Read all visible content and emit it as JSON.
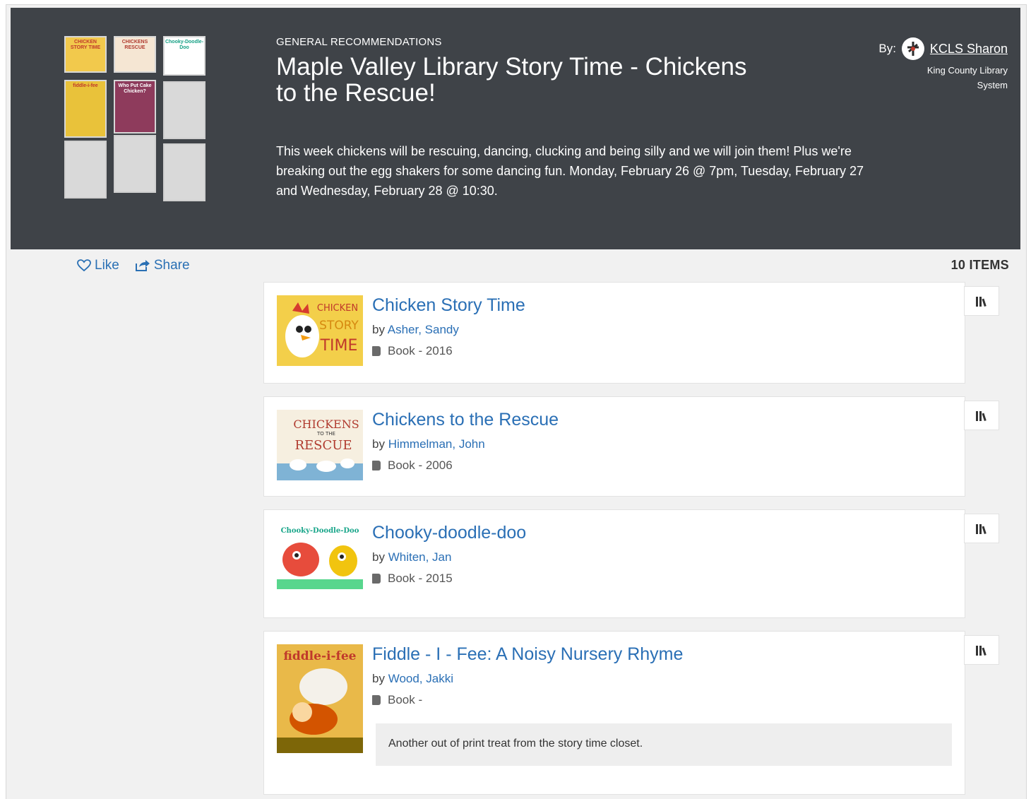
{
  "list": {
    "eyebrow": "GENERAL RECOMMENDATIONS",
    "title": "Maple Valley Library Story Time - Chickens to the Rescue!",
    "description": "This week chickens will be rescuing, dancing, clucking and being silly and we will join them! Plus we're breaking out the egg shakers for some dancing fun. Monday, February 26 @ 7pm, Tuesday, February 27 and Wednesday, February 28 @ 10:30.",
    "by_label": "By:",
    "author": "KCLS Sharon",
    "organization": "King County Library System"
  },
  "actions": {
    "like": "Like",
    "share": "Share"
  },
  "item_count": "10 ITEMS",
  "by_prefix": "by",
  "items": [
    {
      "title": "Chicken Story Time",
      "author": "Asher, Sandy",
      "format": "Book - 2016",
      "cover_text": [
        "CHICKEN",
        "STORY",
        "TIME"
      ]
    },
    {
      "title": "Chickens to the Rescue",
      "author": "Himmelman, John",
      "format": "Book - 2006",
      "cover_text": [
        "CHICKENS",
        "TO THE",
        "RESCUE"
      ]
    },
    {
      "title": "Chooky-doodle-doo",
      "author": "Whiten, Jan",
      "format": "Book - 2015",
      "cover_text": [
        "Chooky-Doodle-Doo"
      ]
    },
    {
      "title": "Fiddle - I - Fee: A Noisy Nursery Rhyme",
      "author": "Wood, Jakki",
      "format": "Book -",
      "cover_text": [
        "fiddle-i-fee"
      ],
      "note": "Another out of print treat from the story time closet."
    }
  ],
  "collage_text": [
    "CHICKEN STORY TIME",
    "CHICKENS RESCUE",
    "Chooky-Doodle-Doo",
    "fiddle-i-fee",
    "Who Put Cake Chicken?"
  ],
  "colors": {
    "hero_bg": "#3f4348",
    "link": "#2a6fb5",
    "page_bg": "#f1f1f1"
  }
}
